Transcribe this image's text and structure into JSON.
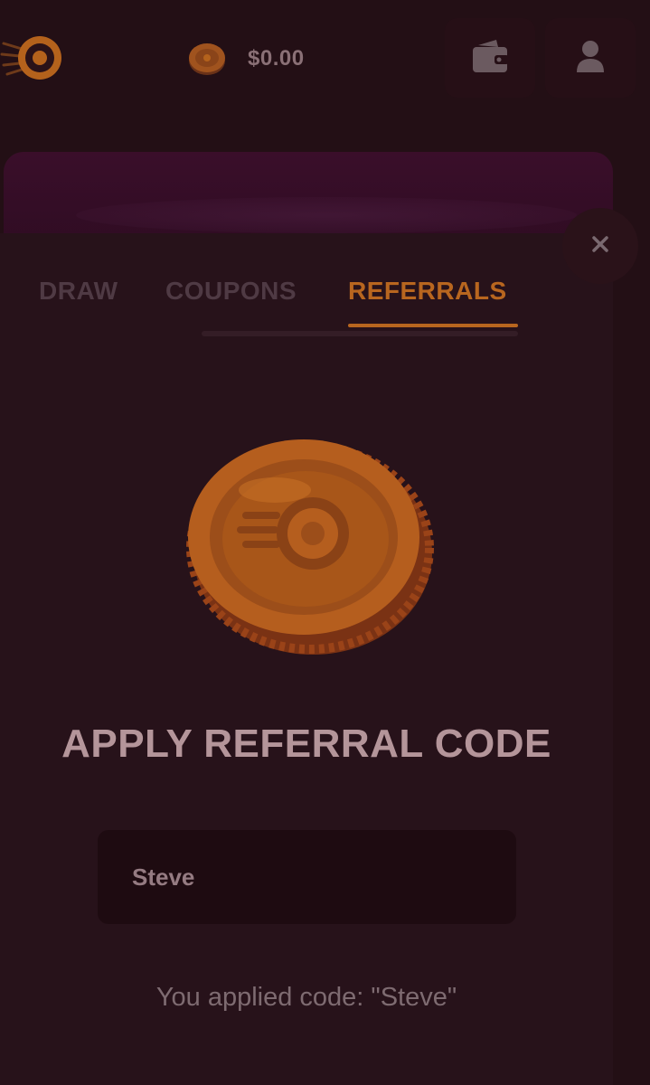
{
  "header": {
    "balance": "$0.00",
    "icons": {
      "logo": "app-logo-icon",
      "coin": "coin-icon",
      "wallet": "wallet-icon",
      "profile": "user-icon"
    }
  },
  "modal": {
    "close_icon": "close-icon",
    "tabs": [
      {
        "label": "DRAW",
        "active": false
      },
      {
        "label": "COUPONS",
        "active": false
      },
      {
        "label": "REFERRALS",
        "active": true
      }
    ],
    "heading": "APPLY REFERRAL CODE",
    "input": {
      "value": "Steve"
    },
    "status": "You applied code: \"Steve\""
  },
  "colors": {
    "background": "#230f15",
    "accent": "#b8661f",
    "heading": "#b4959a",
    "muted": "#4f3a44"
  }
}
